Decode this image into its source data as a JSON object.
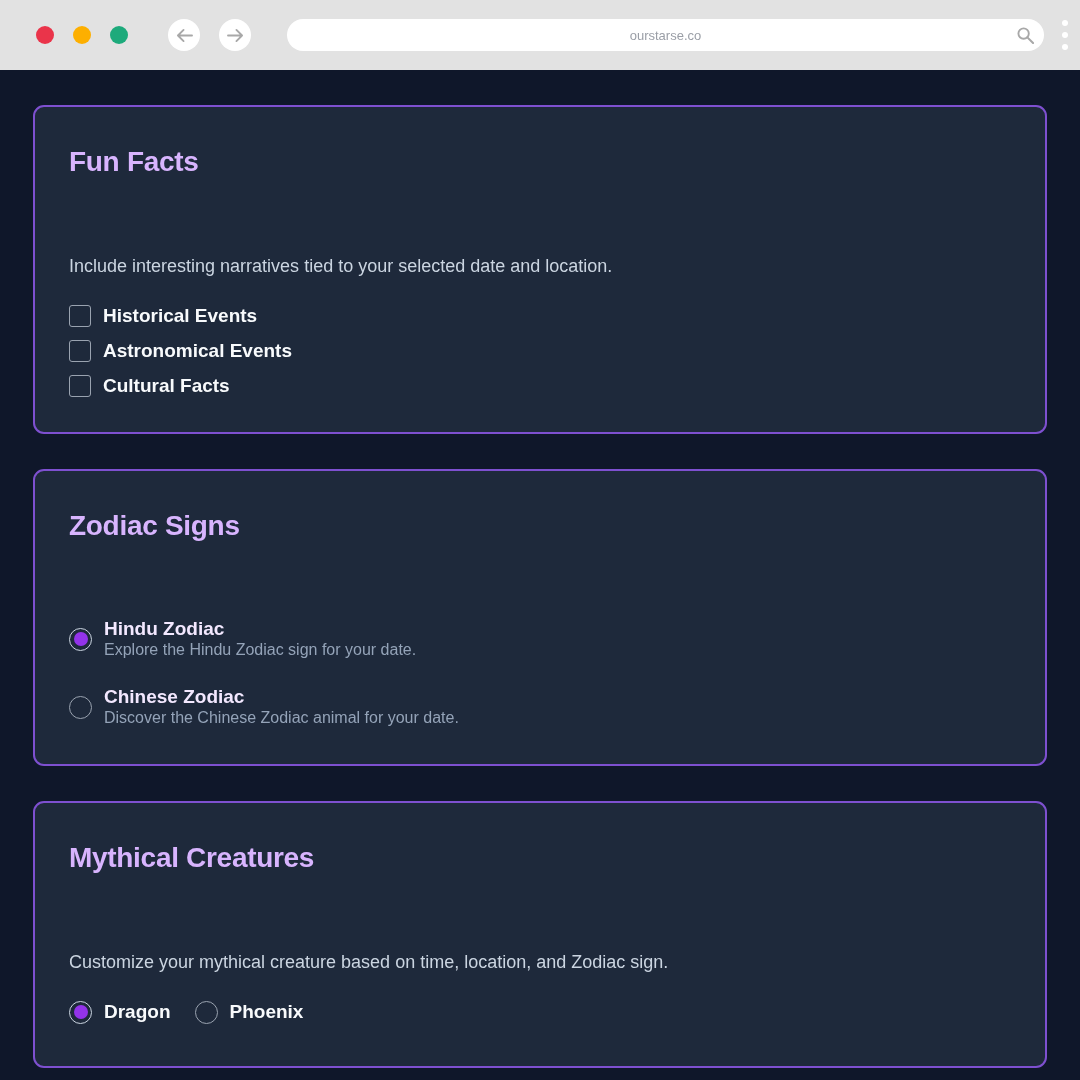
{
  "browser": {
    "url": "ourstarse.co"
  },
  "sections": [
    {
      "kind": "checkboxes",
      "title": "Fun Facts",
      "description": "Include interesting narratives tied to your selected date and location.",
      "options": [
        {
          "label": "Historical Events",
          "checked": false
        },
        {
          "label": "Astronomical Events",
          "checked": false
        },
        {
          "label": "Cultural Facts",
          "checked": false
        }
      ]
    },
    {
      "kind": "radio_list",
      "title": "Zodiac Signs",
      "options": [
        {
          "label": "Hindu Zodiac",
          "description": "Explore the Hindu Zodiac sign for your date.",
          "selected": true
        },
        {
          "label": "Chinese Zodiac",
          "description": "Discover the Chinese Zodiac animal for your date.",
          "selected": false
        }
      ]
    },
    {
      "kind": "radio_inline",
      "title": "Mythical Creatures",
      "description": "Customize your mythical creature based on time, location, and Zodiac sign.",
      "options": [
        {
          "label": "Dragon",
          "selected": true
        },
        {
          "label": "Phoenix",
          "selected": false
        }
      ]
    }
  ]
}
